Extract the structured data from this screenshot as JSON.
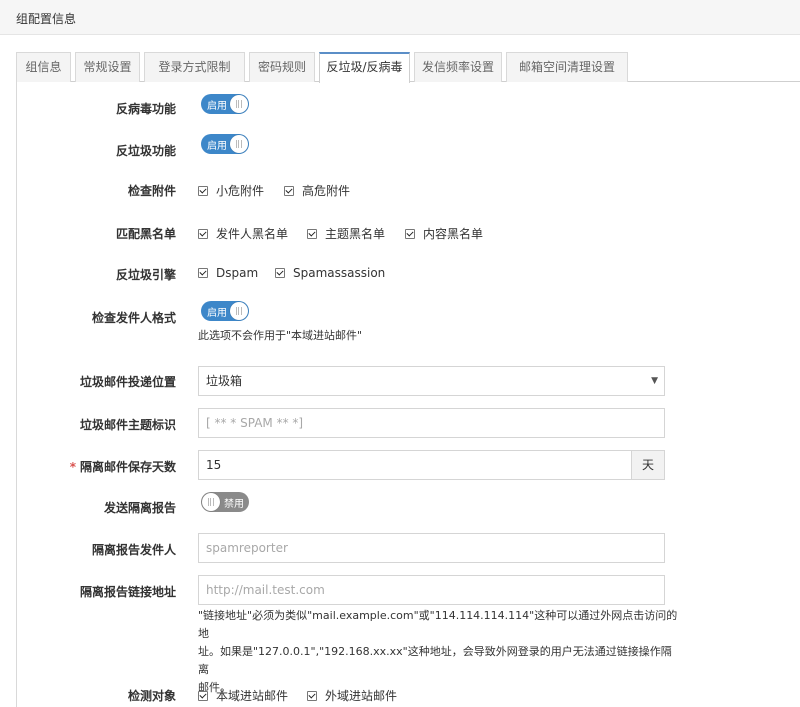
{
  "header": {
    "title": "组配置信息"
  },
  "tabs": [
    {
      "label": "组信息"
    },
    {
      "label": "常规设置"
    },
    {
      "label": "登录方式限制"
    },
    {
      "label": "密码规则"
    },
    {
      "label": "反垃圾/反病毒"
    },
    {
      "label": "发信频率设置"
    },
    {
      "label": "邮箱空间清理设置"
    }
  ],
  "active_tab": "反垃圾/反病毒",
  "form": {
    "antivirus": {
      "label": "反病毒功能",
      "state": "启用"
    },
    "antispam": {
      "label": "反垃圾功能",
      "state": "启用"
    },
    "check_attach": {
      "label": "检查附件",
      "options": [
        "小危附件",
        "高危附件"
      ]
    },
    "blacklist": {
      "label": "匹配黑名单",
      "options": [
        "发件人黑名单",
        "主题黑名单",
        "内容黑名单"
      ]
    },
    "engine": {
      "label": "反垃圾引擎",
      "options": [
        "Dspam",
        "Spamassassion"
      ]
    },
    "sender_format": {
      "label": "检查发件人格式",
      "state": "启用",
      "hint": "此选项不会作用于\"本域进站邮件\""
    },
    "deliver_location": {
      "label": "垃圾邮件投递位置",
      "value": "垃圾箱"
    },
    "subject_tag": {
      "label": "垃圾邮件主题标识",
      "placeholder": "[ ** * SPAM ** *]"
    },
    "quarantine_days": {
      "label": "隔离邮件保存天数",
      "required_mark": "*",
      "value": "15",
      "unit": "天"
    },
    "send_report": {
      "label": "发送隔离报告",
      "state": "禁用"
    },
    "report_sender": {
      "label": "隔离报告发件人",
      "placeholder": "spamreporter"
    },
    "report_link": {
      "label": "隔离报告链接地址",
      "placeholder": "http://mail.test.com",
      "hint_lines": [
        "\"链接地址\"必须为类似\"mail.example.com\"或\"114.114.114.114\"这种可以通过外网点击访问的地",
        "址。如果是\"127.0.0.1\",\"192.168.xx.xx\"这种地址，会导致外网登录的用户无法通过链接操作隔离",
        "邮件。"
      ]
    },
    "detect_target": {
      "label": "检测对象",
      "options": [
        "本域进站邮件",
        "外域进站邮件"
      ]
    }
  },
  "colors": {
    "accent": "#3d87c9",
    "toggle_off": "#8a8a8a",
    "required": "#d9534f"
  }
}
